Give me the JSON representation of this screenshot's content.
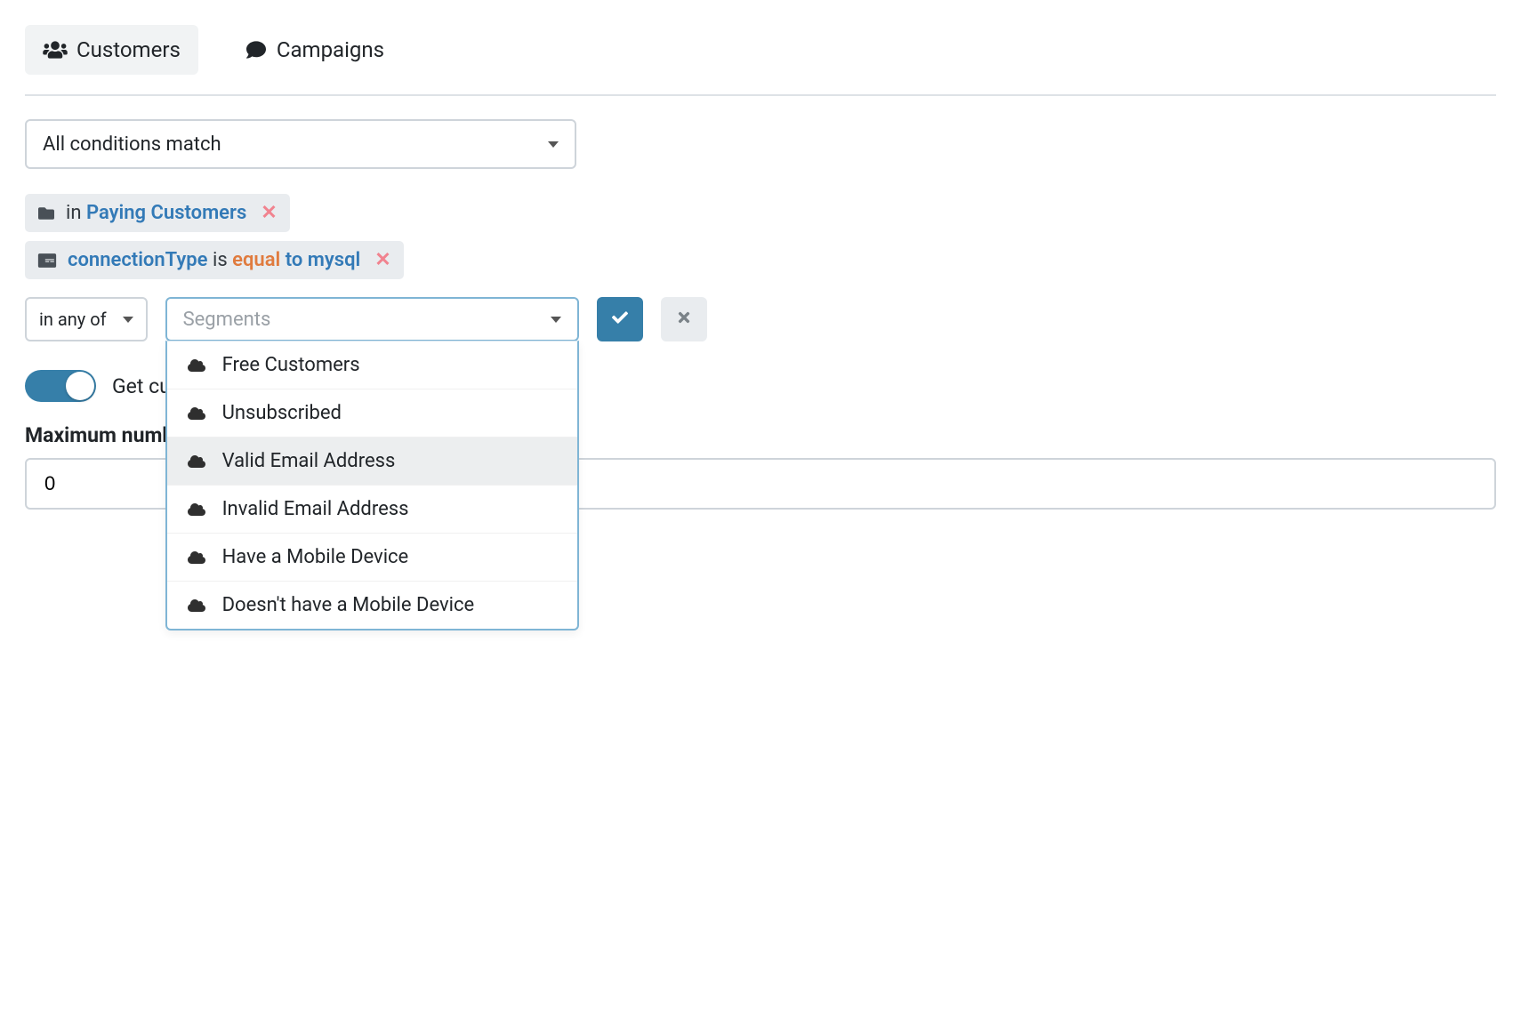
{
  "tabs": {
    "customers": "Customers",
    "campaigns": "Campaigns"
  },
  "condition_select": "All conditions match",
  "chips": {
    "segment": {
      "prefix": "in",
      "name": "Paying Customers"
    },
    "filter": {
      "field": "connectionType",
      "is": "is",
      "op": "equal",
      "to": "to",
      "value": "mysql"
    }
  },
  "builder": {
    "scope": "in any of",
    "segments_placeholder": "Segments",
    "options": [
      "Free Customers",
      "Unsubscribed",
      "Valid Email Address",
      "Invalid Email Address",
      "Have a Mobile Device",
      "Doesn't have a Mobile Device"
    ],
    "hovered_index": 2
  },
  "toggle_label": "Get cus",
  "max_label": "Maximum number",
  "max_value": "0"
}
